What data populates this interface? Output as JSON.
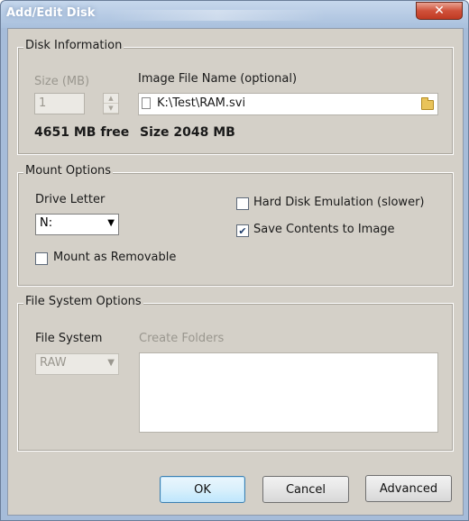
{
  "window": {
    "title": "Add/Edit Disk",
    "close_glyph": "✕"
  },
  "disk_info": {
    "group_title": "Disk Information",
    "size_label": "Size (MB)",
    "size_value": "1",
    "image_file_label": "Image File Name (optional)",
    "image_file_value": "K:\\Test\\RAM.svi",
    "free_text": "4651 MB free",
    "size_text": "Size 2048 MB"
  },
  "mount": {
    "group_title": "Mount Options",
    "drive_letter_label": "Drive Letter",
    "drive_letter_value": "N:",
    "hard_disk_emulation_label": "Hard Disk Emulation (slower)",
    "hard_disk_emulation_checked": false,
    "save_contents_label": "Save Contents to Image",
    "save_contents_checked": true,
    "removable_label": "Mount as Removable",
    "removable_checked": false,
    "check_glyph": "✔"
  },
  "fs": {
    "group_title": "File System Options",
    "file_system_label": "File System",
    "file_system_value": "RAW",
    "create_folders_label": "Create Folders",
    "create_folders_value": ""
  },
  "buttons": {
    "ok": "OK",
    "cancel": "Cancel",
    "advanced": "Advanced"
  },
  "icons": {
    "combo_arrow": "▼",
    "spin_up": "▲",
    "spin_down": "▼"
  }
}
